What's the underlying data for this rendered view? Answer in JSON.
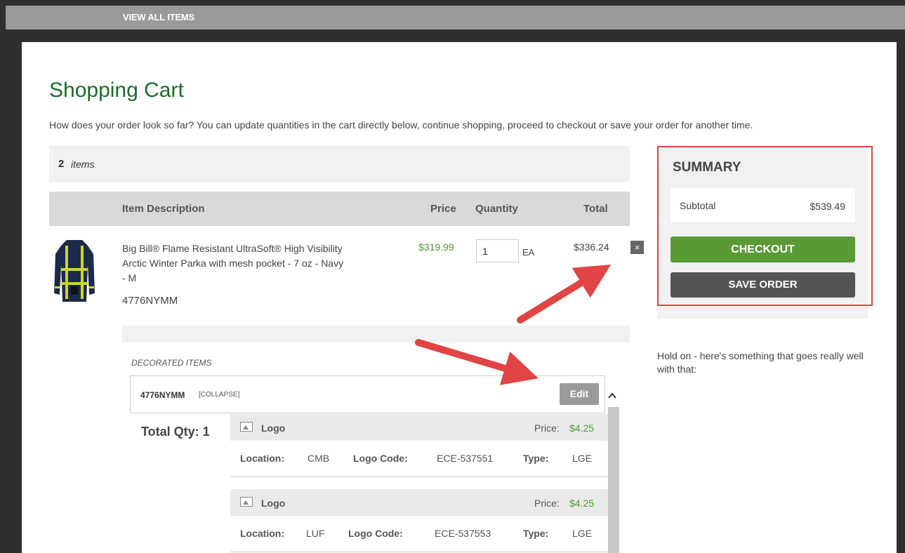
{
  "nav": {
    "view_all": "VIEW ALL ITEMS"
  },
  "page": {
    "title": "Shopping Cart",
    "intro": "How does your order look so far? You can update quantities in the cart directly below, continue shopping, proceed to checkout or save your order for another time."
  },
  "cart": {
    "item_count": "2",
    "item_word": "items",
    "headers": {
      "description": "Item Description",
      "price": "Price",
      "quantity": "Quantity",
      "total": "Total"
    },
    "item": {
      "description": "Big Bill® Flame Resistant UltraSoft® High Visibility Arctic Winter Parka with mesh pocket - 7 oz - Navy - M",
      "sku": "4776NYMM",
      "price": "$319.99",
      "quantity": "1",
      "uom": "EA",
      "total": "$336.24",
      "remove": "×"
    },
    "decorated": {
      "label": "DECORATED ITEMS",
      "sku": "4776NYMM",
      "collapse": "[COLLAPSE]",
      "edit": "Edit",
      "total_qty": "Total Qty: 1",
      "logos": [
        {
          "name": "Logo",
          "price_label": "Price:",
          "price": "$4.25",
          "location_label": "Location:",
          "location": "CMB",
          "code_label": "Logo Code:",
          "code": "ECE-537551",
          "type_label": "Type:",
          "type": "LGE"
        },
        {
          "name": "Logo",
          "price_label": "Price:",
          "price": "$4.25",
          "location_label": "Location:",
          "location": "LUF",
          "code_label": "Logo Code:",
          "code": "ECE-537553",
          "type_label": "Type:",
          "type": "LGE"
        }
      ]
    }
  },
  "summary": {
    "title": "SUMMARY",
    "subtotal_label": "Subtotal",
    "subtotal": "$539.49",
    "checkout": "CHECKOUT",
    "save_order": "SAVE ORDER"
  },
  "upsell": {
    "text": "Hold on - here's something that goes really well with that:"
  },
  "colors": {
    "title_green": "#1e6b2e",
    "checkout_green": "#5a9a35",
    "price_green": "#4e9a2e",
    "highlight_red": "#e04444"
  },
  "icons": {
    "remove": "close-icon",
    "logo": "image-icon",
    "scroll": "chevron-up-icon"
  }
}
